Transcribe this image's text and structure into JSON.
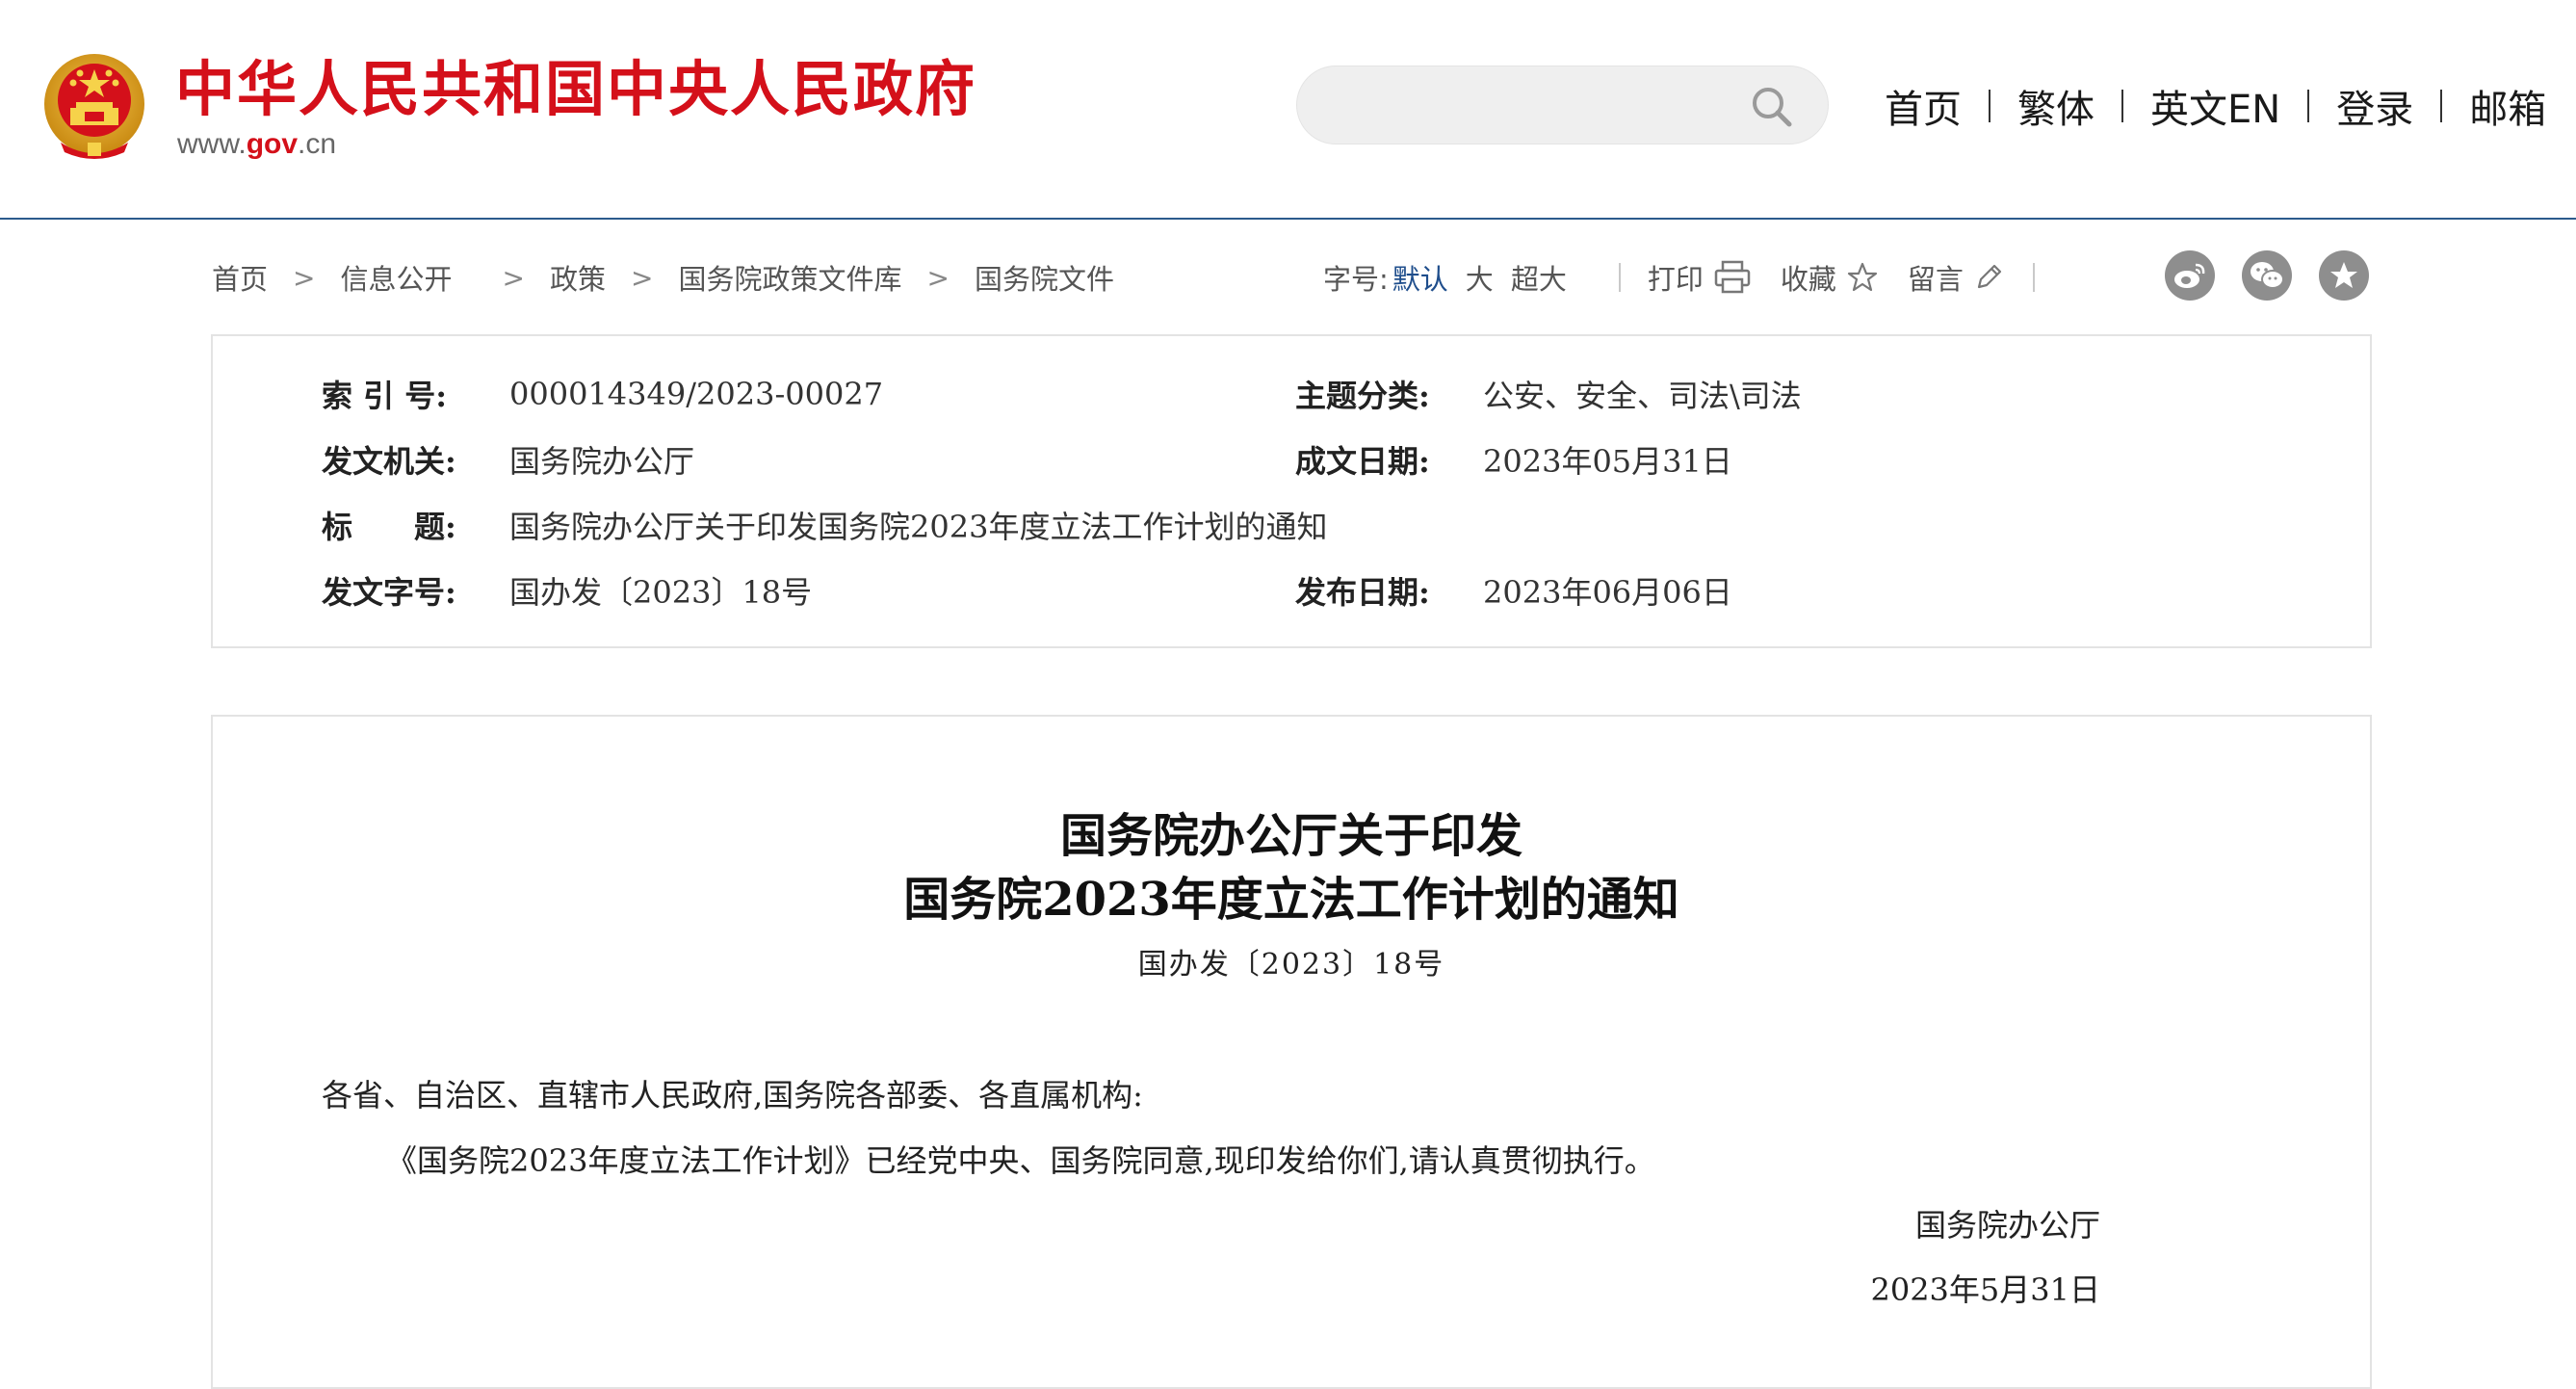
{
  "header": {
    "site_title": "中华人民共和国中央人民政府",
    "site_domain_prefix": "www.",
    "site_domain_gov": "gov",
    "site_domain_suffix": ".cn",
    "search_placeholder": "",
    "nav": [
      "首页",
      "繁体",
      "英文EN",
      "登录",
      "邮箱"
    ],
    "brand_color": "#d4101a"
  },
  "breadcrumb": [
    "首页",
    "信息公开",
    "政策",
    "国务院政策文件库",
    "国务院文件"
  ],
  "tools": {
    "font_size_label": "字号:",
    "font_size_options": [
      "默认",
      "大",
      "超大"
    ],
    "print": "打印",
    "favorite": "收藏",
    "comment": "留言",
    "share_icons": [
      "weibo-icon",
      "wechat-icon",
      "star-icon"
    ]
  },
  "meta": {
    "index_label": "索 引 号:",
    "index_value": "000014349/2023-00027",
    "category_label": "主题分类:",
    "category_value": "公安、安全、司法\\司法",
    "issuer_label": "发文机关:",
    "issuer_value": "国务院办公厅",
    "written_date_label": "成文日期:",
    "written_date_value": "2023年05月31日",
    "title_label": "标　　题:",
    "title_value": "国务院办公厅关于印发国务院2023年度立法工作计划的通知",
    "doc_no_label": "发文字号:",
    "doc_no_value": "国办发〔2023〕18号",
    "publish_date_label": "发布日期:",
    "publish_date_value": "2023年06月06日"
  },
  "document": {
    "title_line1": "国务院办公厅关于印发",
    "title_line2": "国务院2023年度立法工作计划的通知",
    "doc_number": "国办发〔2023〕18号",
    "salutation": "各省、自治区、直辖市人民政府,国务院各部委、各直属机构:",
    "body": "《国务院2023年度立法工作计划》已经党中央、国务院同意,现印发给你们,请认真贯彻执行。",
    "signature": "国务院办公厅",
    "date": "2023年5月31日"
  }
}
